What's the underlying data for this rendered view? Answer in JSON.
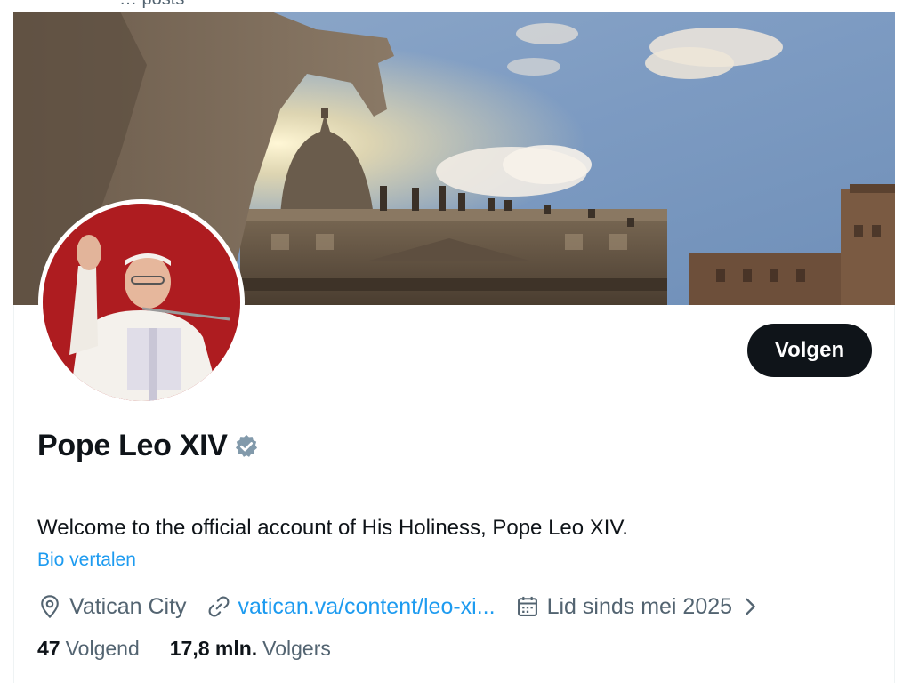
{
  "header": {
    "posts_label": "… posts"
  },
  "profile": {
    "name": "Pope Leo XIV",
    "follow_label": "Volgen",
    "bio": "Welcome to the official account of His Holiness, Pope Leo XIV.",
    "translate_label": "Bio vertalen",
    "location": "Vatican City",
    "website": "vatican.va/content/leo-xi...",
    "joined": "Lid sinds mei 2025"
  },
  "stats": {
    "following_count": "47",
    "following_label": "Volgend",
    "followers_count": "17,8 mln.",
    "followers_label": "Volgers"
  },
  "icons": {
    "verified": "verified-badge-icon",
    "location": "location-pin-icon",
    "link": "link-icon",
    "calendar": "calendar-icon",
    "chevron": "chevron-right-icon"
  },
  "colors": {
    "accent": "#1d9bf0",
    "text_primary": "#0f1419",
    "text_secondary": "#536471",
    "button_bg": "#0f1419",
    "verified_gray": "#829aab"
  }
}
